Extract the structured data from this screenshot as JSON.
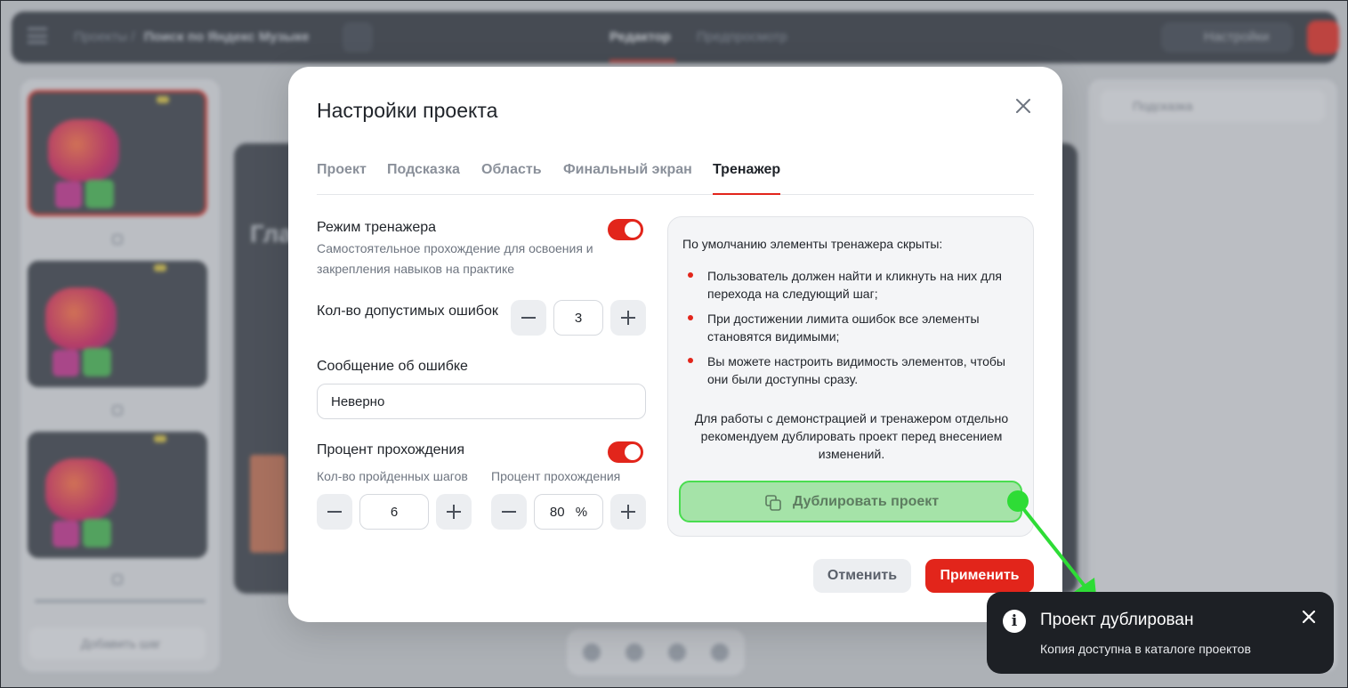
{
  "background": {
    "breadcrumb": {
      "root": "Проекты",
      "separator": "/",
      "project": "Поиск по Яндекс Музыке"
    },
    "tabs": [
      "Редактор",
      "Предпросмотр"
    ],
    "settings_label": "Настройки",
    "add_step_label": "Добавить шаг",
    "canvas_heading": "Гла",
    "right_panel_label": "Подсказка"
  },
  "modal": {
    "title": "Настройки проекта",
    "tabs": [
      "Проект",
      "Подсказка",
      "Область",
      "Финальный экран",
      "Тренажер"
    ],
    "active_tab": "Тренажер",
    "trainer_mode": {
      "label": "Режим тренажера",
      "description": "Самостоятельное прохождение для освоения и закрепления навыков на практике",
      "enabled": true
    },
    "errors_allowed": {
      "label": "Кол-во допустимых ошибок",
      "value": "3"
    },
    "error_message": {
      "label": "Сообщение об ошибке",
      "value": "Неверно"
    },
    "pass_percent": {
      "label": "Процент прохождения",
      "enabled": true,
      "steps_label": "Кол-во пройденных шагов",
      "steps_value": "6",
      "percent_label": "Процент прохождения",
      "percent_value": "80",
      "percent_unit": "%"
    },
    "info": {
      "heading": "По умолчанию элементы тренажера скрыты:",
      "bullets": [
        "Пользователь должен найти и кликнуть на них для перехода на следующий шаг;",
        "При достижении лимита ошибок все элементы становятся видимыми;",
        "Вы можете настроить видимость элементов, чтобы они были доступны сразу."
      ],
      "note": "Для работы с демонстрацией и тренажером отдельно рекомендуем дублировать проект перед внесением изменений.",
      "duplicate_button": "Дублировать проект"
    },
    "cancel_label": "Отменить",
    "apply_label": "Применить"
  },
  "toast": {
    "title": "Проект дублирован",
    "text": "Копия доступна в каталоге проектов"
  },
  "colors": {
    "accent": "#e2251b",
    "highlight": "#49dd4f",
    "toast_bg": "#1d2025"
  },
  "icons": {
    "close": "close-icon",
    "copy": "copy-icon",
    "info": "info-icon"
  }
}
